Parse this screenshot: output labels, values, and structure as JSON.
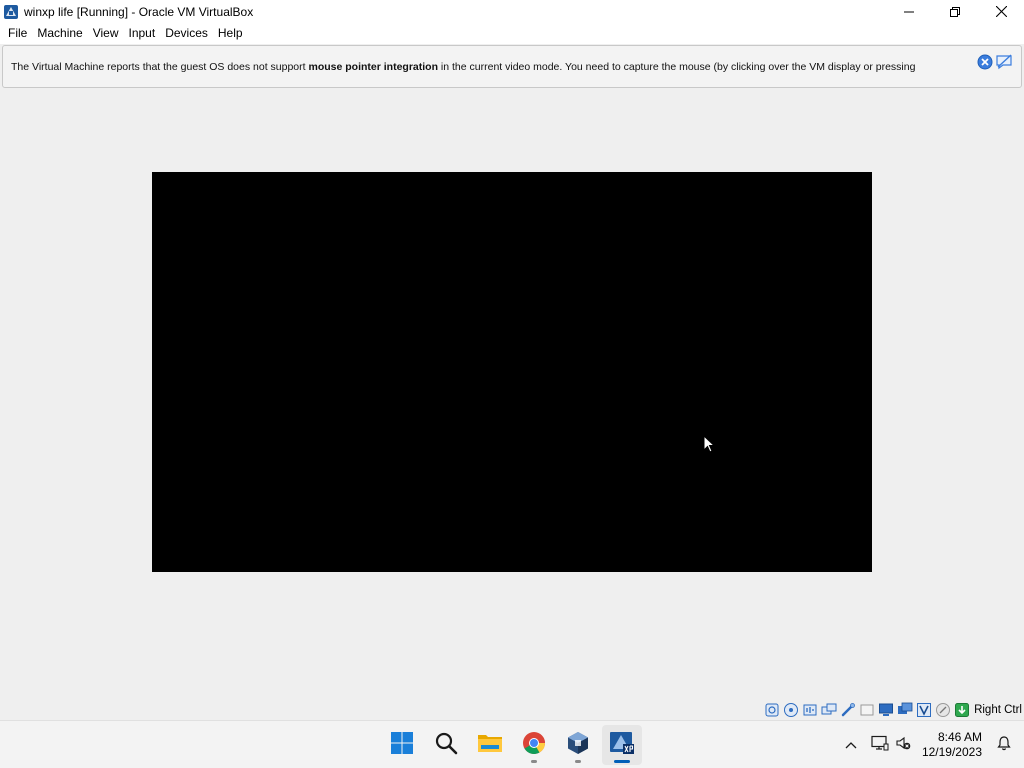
{
  "window": {
    "title": "winxp life [Running] - Oracle VM VirtualBox",
    "app_icon": "virtualbox-icon"
  },
  "window_controls": [
    "minimize-icon",
    "maximize-icon",
    "close-icon"
  ],
  "menu": {
    "items": [
      "File",
      "Machine",
      "View",
      "Input",
      "Devices",
      "Help"
    ]
  },
  "notification": {
    "text_before": "The Virtual Machine reports that the guest OS does not support ",
    "text_bold": "mouse pointer integration",
    "text_after": " in the current video mode. You need to capture the mouse (by clicking over the VM display or pressing",
    "buttons": [
      "close-notification-icon",
      "do-not-show-again-icon"
    ],
    "accent_color": "#3b7ddd"
  },
  "vm_display": {
    "background": "#000000"
  },
  "status_bar": {
    "icons": [
      "hard-disk-icon",
      "optical-drive-icon",
      "audio-icon",
      "network-icon",
      "usb-icon",
      "shared-folders-icon",
      "display-icon",
      "video-capture-icon",
      "virtualization-icon",
      "mouse-integration-icon",
      "keyboard-capture-icon"
    ],
    "host_key": "Right Ctrl"
  },
  "taskbar": {
    "apps": [
      "windows-start-icon",
      "search-icon",
      "file-explorer-icon",
      "chrome-icon",
      "virtualbox-manager-icon",
      "winxp-vm-icon"
    ],
    "tray_icons": [
      "chevron-up-icon",
      "network-icon",
      "volume-muted-icon"
    ],
    "time": "8:46 AM",
    "date": "12/19/2023",
    "notification_icon": "bell-icon"
  }
}
